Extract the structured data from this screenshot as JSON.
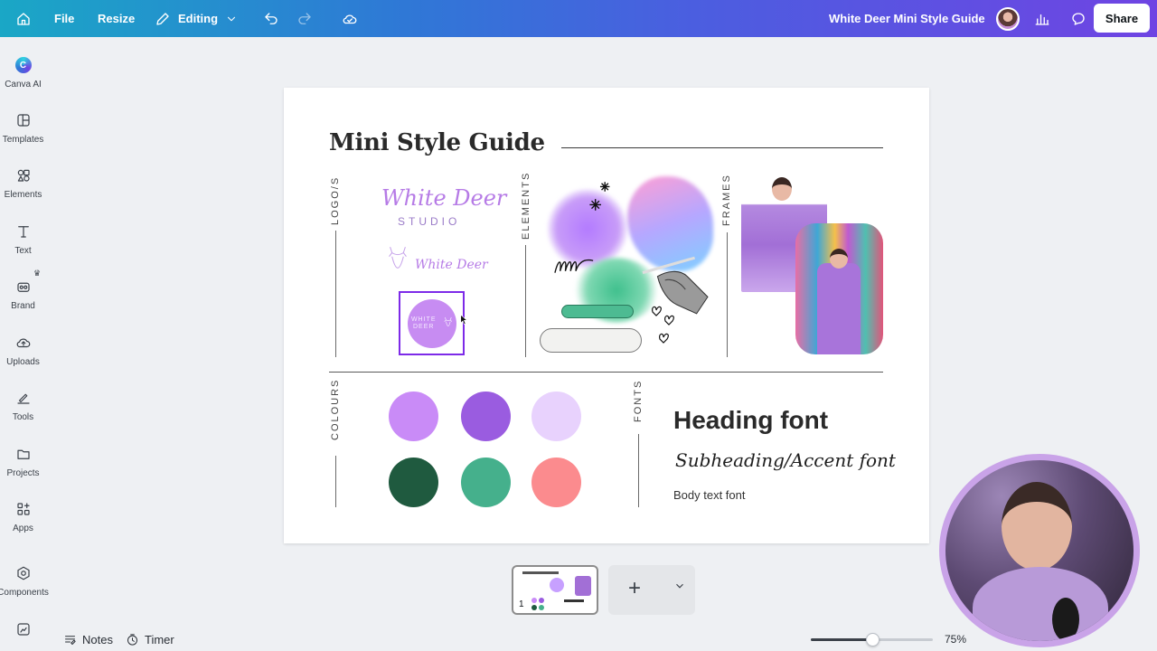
{
  "topbar": {
    "file": "File",
    "resize": "Resize",
    "mode": "Editing",
    "doc_title": "White Deer Mini Style Guide",
    "share": "Share"
  },
  "sidebar": {
    "items": [
      {
        "label": "Canva AI",
        "icon": "canva-ai-icon"
      },
      {
        "label": "Templates",
        "icon": "templates-icon"
      },
      {
        "label": "Elements",
        "icon": "elements-icon"
      },
      {
        "label": "Text",
        "icon": "text-icon"
      },
      {
        "label": "Brand",
        "icon": "brand-icon"
      },
      {
        "label": "Uploads",
        "icon": "uploads-icon"
      },
      {
        "label": "Tools",
        "icon": "tools-icon"
      },
      {
        "label": "Projects",
        "icon": "projects-icon"
      },
      {
        "label": "Apps",
        "icon": "apps-icon"
      },
      {
        "label": "Components",
        "icon": "components-icon"
      }
    ]
  },
  "design": {
    "title": "Mini Style Guide",
    "sections": {
      "logos": "LOGO/S",
      "elements": "ELEMENTS",
      "frames": "FRAMES",
      "colours": "COLOURS",
      "fonts": "FONTS"
    },
    "logo_text_1": "White Deer",
    "logo_studio": "STUDIO",
    "logo_text_2": "White Deer",
    "badge_text_top": "WHITE DEER",
    "palette": [
      "#c98bf7",
      "#9a5ce0",
      "#e8d2fd",
      "#1f5a3f",
      "#45b08c",
      "#fb8b8e"
    ],
    "font_heading": "Heading font",
    "font_sub": "Subheading/Accent font",
    "font_body": "Body text font"
  },
  "bottom": {
    "notes": "Notes",
    "timer": "Timer",
    "page_number": "1",
    "zoom": "75%",
    "zoom_level": 0.5
  }
}
